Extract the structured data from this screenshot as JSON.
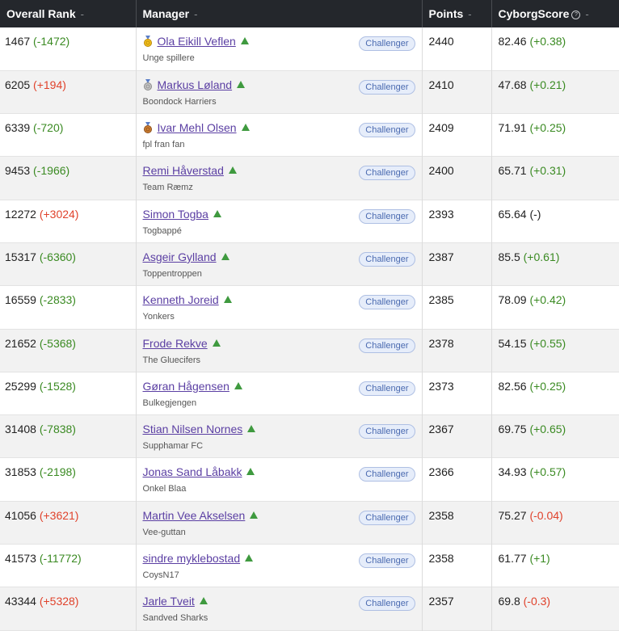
{
  "table": {
    "headers": {
      "rank": "Overall Rank",
      "manager": "Manager",
      "points": "Points",
      "cyborg": "CyborgScore"
    },
    "sort_icon": "-",
    "help_icon": "question-circle-icon",
    "colors": {
      "header_bg": "#24272c",
      "positive": "#3a8a22",
      "negative": "#e0422b",
      "link": "#5b3fa3",
      "badge_bg": "#e6edfa"
    },
    "rows": [
      {
        "rank": "1467",
        "rank_change": "(-1472)",
        "rank_dir": "pos",
        "medal": "gold",
        "manager": "Ola Eikill Veflen",
        "team": "Unge spillere",
        "badge": "Challenger",
        "points": "2440",
        "score": "82.46",
        "score_change": "(+0.38)",
        "score_dir": "pos"
      },
      {
        "rank": "6205",
        "rank_change": "(+194)",
        "rank_dir": "neg",
        "medal": "silver",
        "manager": "Markus Løland",
        "team": "Boondock Harriers",
        "badge": "Challenger",
        "points": "2410",
        "score": "47.68",
        "score_change": "(+0.21)",
        "score_dir": "pos"
      },
      {
        "rank": "6339",
        "rank_change": "(-720)",
        "rank_dir": "pos",
        "medal": "bronze",
        "manager": "Ivar Mehl Olsen",
        "team": "fpl fran fan",
        "badge": "Challenger",
        "points": "2409",
        "score": "71.91",
        "score_change": "(+0.25)",
        "score_dir": "pos"
      },
      {
        "rank": "9453",
        "rank_change": "(-1966)",
        "rank_dir": "pos",
        "medal": "",
        "manager": "Remi Håverstad",
        "team": "Team Ræmz",
        "badge": "Challenger",
        "points": "2400",
        "score": "65.71",
        "score_change": "(+0.31)",
        "score_dir": "pos"
      },
      {
        "rank": "12272",
        "rank_change": "(+3024)",
        "rank_dir": "neg",
        "medal": "",
        "manager": "Simon Togba",
        "team": "Togbappé",
        "badge": "Challenger",
        "points": "2393",
        "score": "65.64",
        "score_change": "(-)",
        "score_dir": "neutral"
      },
      {
        "rank": "15317",
        "rank_change": "(-6360)",
        "rank_dir": "pos",
        "medal": "",
        "manager": "Asgeir Gylland",
        "team": "Toppentroppen",
        "badge": "Challenger",
        "points": "2387",
        "score": "85.5",
        "score_change": "(+0.61)",
        "score_dir": "pos"
      },
      {
        "rank": "16559",
        "rank_change": "(-2833)",
        "rank_dir": "pos",
        "medal": "",
        "manager": "Kenneth Joreid",
        "team": "Yonkers",
        "badge": "Challenger",
        "points": "2385",
        "score": "78.09",
        "score_change": "(+0.42)",
        "score_dir": "pos"
      },
      {
        "rank": "21652",
        "rank_change": "(-5368)",
        "rank_dir": "pos",
        "medal": "",
        "manager": "Frode Rekve",
        "team": "The Gluecifers",
        "badge": "Challenger",
        "points": "2378",
        "score": "54.15",
        "score_change": "(+0.55)",
        "score_dir": "pos"
      },
      {
        "rank": "25299",
        "rank_change": "(-1528)",
        "rank_dir": "pos",
        "medal": "",
        "manager": "Gøran Hågensen",
        "team": "Bulkegjengen",
        "badge": "Challenger",
        "points": "2373",
        "score": "82.56",
        "score_change": "(+0.25)",
        "score_dir": "pos"
      },
      {
        "rank": "31408",
        "rank_change": "(-7838)",
        "rank_dir": "pos",
        "medal": "",
        "manager": "Stian Nilsen Nornes",
        "team": "Supphamar FC",
        "badge": "Challenger",
        "points": "2367",
        "score": "69.75",
        "score_change": "(+0.65)",
        "score_dir": "pos"
      },
      {
        "rank": "31853",
        "rank_change": "(-2198)",
        "rank_dir": "pos",
        "medal": "",
        "manager": "Jonas Sand Låbakk",
        "team": "Onkel Blaa",
        "badge": "Challenger",
        "points": "2366",
        "score": "34.93",
        "score_change": "(+0.57)",
        "score_dir": "pos"
      },
      {
        "rank": "41056",
        "rank_change": "(+3621)",
        "rank_dir": "neg",
        "medal": "",
        "manager": "Martin Vee Akselsen",
        "team": "Vee-guttan",
        "badge": "Challenger",
        "points": "2358",
        "score": "75.27",
        "score_change": "(-0.04)",
        "score_dir": "neg"
      },
      {
        "rank": "41573",
        "rank_change": "(-11772)",
        "rank_dir": "pos",
        "medal": "",
        "manager": "sindre myklebostad",
        "team": "CoysN17",
        "badge": "Challenger",
        "points": "2358",
        "score": "61.77",
        "score_change": "(+1)",
        "score_dir": "pos"
      },
      {
        "rank": "43344",
        "rank_change": "(+5328)",
        "rank_dir": "neg",
        "medal": "",
        "manager": "Jarle Tveit",
        "team": "Sandved Sharks",
        "badge": "Challenger",
        "points": "2357",
        "score": "69.8",
        "score_change": "(-0.3)",
        "score_dir": "neg"
      }
    ]
  }
}
